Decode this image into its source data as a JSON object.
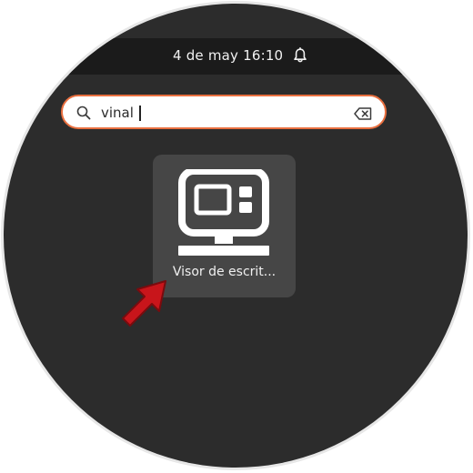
{
  "topbar": {
    "clock": "4 de may  16:10",
    "icons": [
      "bell-icon"
    ]
  },
  "search": {
    "value": "vinal",
    "icons": [
      "search-icon",
      "backspace-clear-icon"
    ]
  },
  "results": [
    {
      "label": "Visor de escrit...",
      "icon": "remote-desktop-viewer-icon"
    }
  ],
  "annotation": {
    "icon": "red-pointer-arrow-icon"
  },
  "colors": {
    "background": "#2c2c2c",
    "topbar": "#1b1b1b",
    "search_border": "#e96f3f",
    "tile": "#464646",
    "arrow": "#c8151b"
  }
}
